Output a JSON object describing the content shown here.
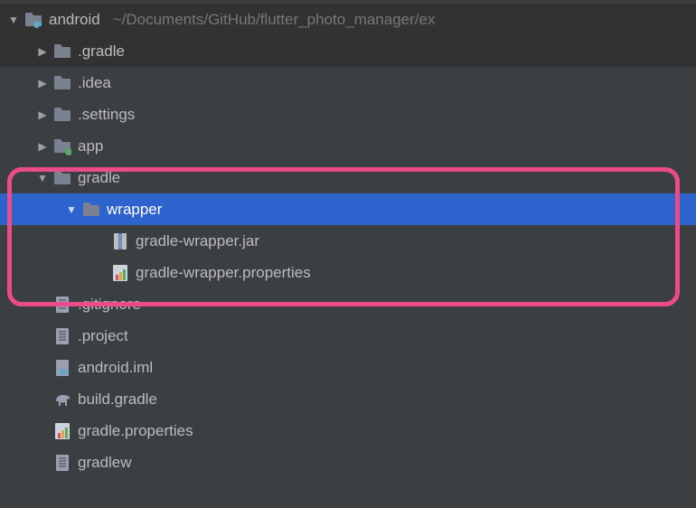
{
  "root": {
    "name": "android",
    "path": "~/Documents/GitHub/flutter_photo_manager/ex"
  },
  "items": {
    "gradle_dir": ".gradle",
    "idea": ".idea",
    "settings": ".settings",
    "app": "app",
    "gradle": "gradle",
    "wrapper": "wrapper",
    "wrapper_jar": "gradle-wrapper.jar",
    "wrapper_props": "gradle-wrapper.properties",
    "gitignore": ".gitignore",
    "project": ".project",
    "iml": "android.iml",
    "build_gradle": "build.gradle",
    "gradle_props": "gradle.properties",
    "gradlew": "gradlew"
  }
}
